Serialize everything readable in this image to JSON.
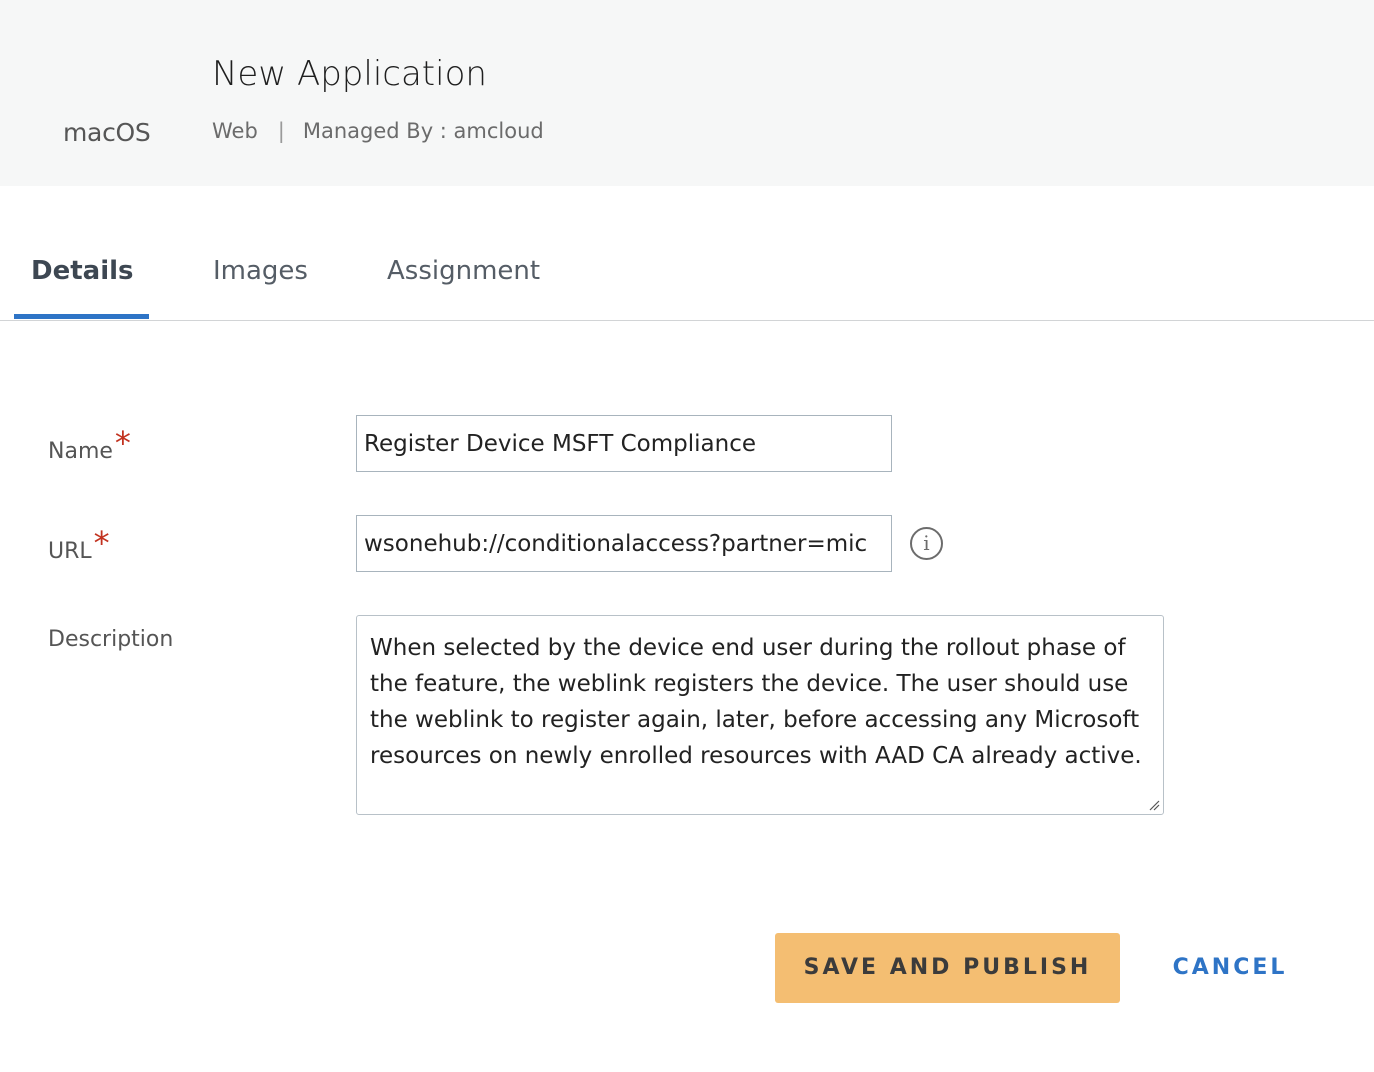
{
  "header": {
    "platform": "macOS",
    "title": "New Application",
    "type": "Web",
    "separator": "|",
    "managed_by": "Managed By : amcloud"
  },
  "tabs": [
    {
      "label": "Details",
      "active": true
    },
    {
      "label": "Images",
      "active": false
    },
    {
      "label": "Assignment",
      "active": false
    }
  ],
  "form": {
    "required_marker": "*",
    "name": {
      "label": "Name",
      "value": "Register Device MSFT Compliance"
    },
    "url": {
      "label": "URL",
      "value": "wsonehub://conditionalaccess?partner=mic",
      "info_icon": "info-icon"
    },
    "description": {
      "label": "Description",
      "value": "When selected by the device end user during the rollout phase of the feature, the weblink registers the device. The user should use the weblink to register again, later, before accessing any Microsoft resources on newly enrolled resources with AAD CA already active."
    }
  },
  "actions": {
    "save_publish": "SAVE AND PUBLISH",
    "cancel": "CANCEL"
  },
  "colors": {
    "accent": "#2e74c6",
    "required": "#c2321f",
    "primary_button": "#f4be72",
    "header_bg": "#f6f7f7"
  }
}
